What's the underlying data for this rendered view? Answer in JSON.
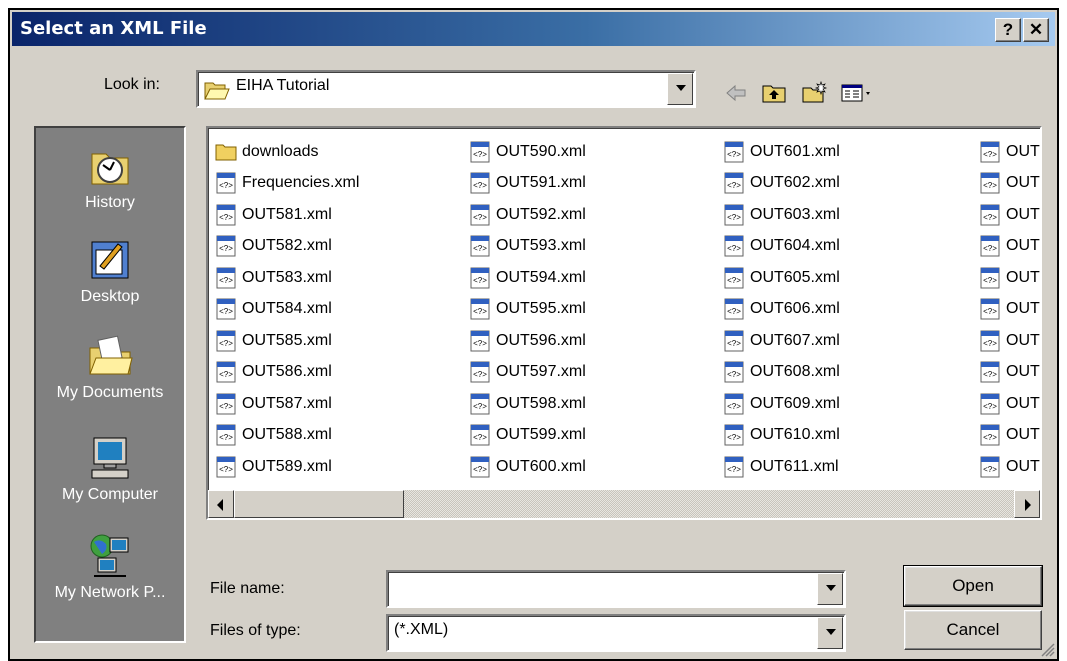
{
  "window": {
    "title": "Select an XML File",
    "help_label": "?",
    "close_label": "✕"
  },
  "lookin": {
    "label": "Look in:",
    "value": "EIHA Tutorial"
  },
  "toolbar": {
    "back_icon": "back-arrow-icon",
    "up_icon": "up-folder-icon",
    "new_folder_icon": "new-folder-icon",
    "view_icon": "view-menu-icon"
  },
  "places": [
    {
      "label": "History",
      "icon": "history-icon"
    },
    {
      "label": "Desktop",
      "icon": "desktop-icon"
    },
    {
      "label": "My Documents",
      "icon": "my-documents-icon"
    },
    {
      "label": "My Computer",
      "icon": "my-computer-icon"
    },
    {
      "label": "My Network P...",
      "icon": "network-places-icon"
    }
  ],
  "files": {
    "col1": [
      "downloads",
      "Frequencies.xml",
      "OUT581.xml",
      "OUT582.xml",
      "OUT583.xml",
      "OUT584.xml",
      "OUT585.xml",
      "OUT586.xml",
      "OUT587.xml",
      "OUT588.xml",
      "OUT589.xml"
    ],
    "col2": [
      "OUT590.xml",
      "OUT591.xml",
      "OUT592.xml",
      "OUT593.xml",
      "OUT594.xml",
      "OUT595.xml",
      "OUT596.xml",
      "OUT597.xml",
      "OUT598.xml",
      "OUT599.xml",
      "OUT600.xml"
    ],
    "col3": [
      "OUT601.xml",
      "OUT602.xml",
      "OUT603.xml",
      "OUT604.xml",
      "OUT605.xml",
      "OUT606.xml",
      "OUT607.xml",
      "OUT608.xml",
      "OUT609.xml",
      "OUT610.xml",
      "OUT611.xml"
    ],
    "col4": [
      "OUT",
      "OUT",
      "OUT",
      "OUT",
      "OUT",
      "OUT",
      "OUT",
      "OUT",
      "OUT",
      "OUT",
      "OUT"
    ]
  },
  "filename": {
    "label": "File name:",
    "value": ""
  },
  "filetype": {
    "label": "Files of type:",
    "value": "(*.XML)"
  },
  "buttons": {
    "open": "Open",
    "cancel": "Cancel"
  }
}
